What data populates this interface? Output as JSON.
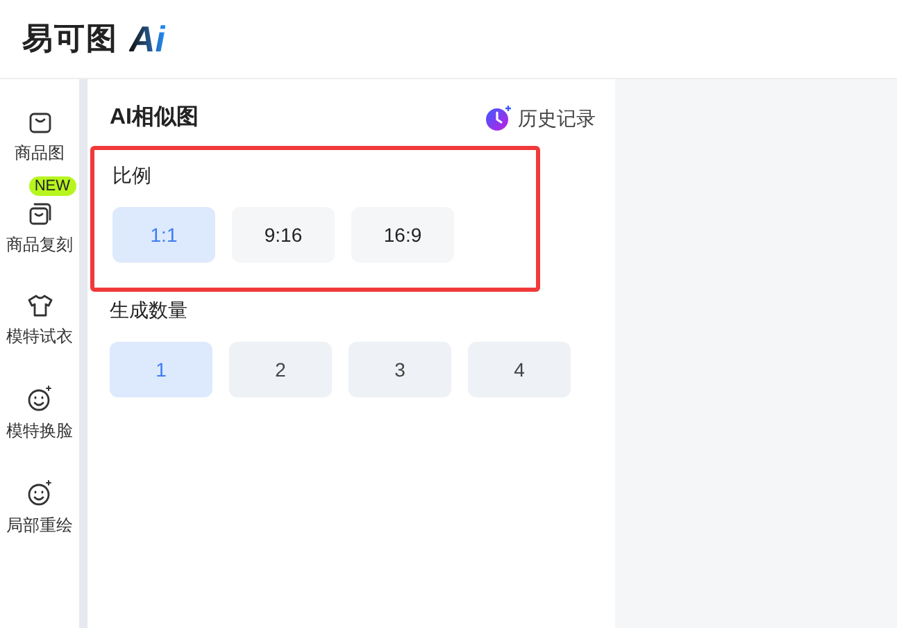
{
  "logo": {
    "name": "易可图",
    "mark": "Ai"
  },
  "sidebar": {
    "items": [
      {
        "label": "商品图",
        "kind": "bag",
        "selected": false
      },
      {
        "label": "商品复刻",
        "kind": "bags",
        "badge": "NEW",
        "selected": false
      },
      {
        "label": "模特试衣",
        "kind": "shirt",
        "selected": false
      },
      {
        "label": "模特换脸",
        "kind": "face",
        "selected": false
      },
      {
        "label": "局部重绘",
        "kind": "face",
        "selected": false
      }
    ]
  },
  "panel": {
    "title": "AI相似图",
    "history": "历史记录",
    "sections": [
      {
        "label": "比例",
        "highlighted": true,
        "options": [
          {
            "label": "1:1",
            "selected": true
          },
          {
            "label": "9:16",
            "selected": false
          },
          {
            "label": "16:9",
            "selected": false
          }
        ]
      },
      {
        "label": "生成数量",
        "highlighted": false,
        "options": [
          {
            "label": "1",
            "selected": true
          },
          {
            "label": "2",
            "selected": false
          },
          {
            "label": "3",
            "selected": false
          },
          {
            "label": "4",
            "selected": false
          }
        ]
      }
    ]
  }
}
